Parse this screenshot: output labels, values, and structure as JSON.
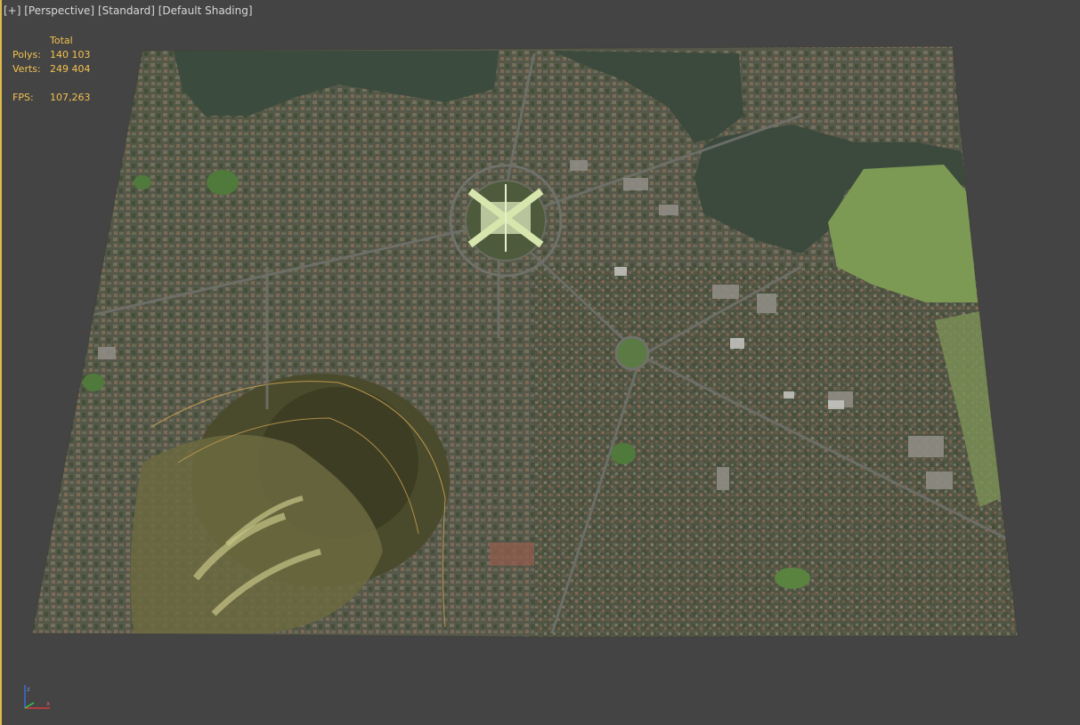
{
  "viewport": {
    "menu_plus": "[+]",
    "view_mode": "[Perspective]",
    "render_style": "[Standard]",
    "shading": "[Default Shading]"
  },
  "stats": {
    "header": "Total",
    "polys_label": "Polys:",
    "polys_value": "140 103",
    "verts_label": "Verts:",
    "verts_value": "249 404",
    "fps_label": "FPS:",
    "fps_value": "107,263"
  },
  "colors": {
    "viewport_bg": "#444444",
    "stats_text": "#f2c14e",
    "label_text": "#d8d8d8",
    "active_border": "#e1b94a"
  },
  "icons": {
    "axis_gizmo": "xyz-axis-icon"
  }
}
